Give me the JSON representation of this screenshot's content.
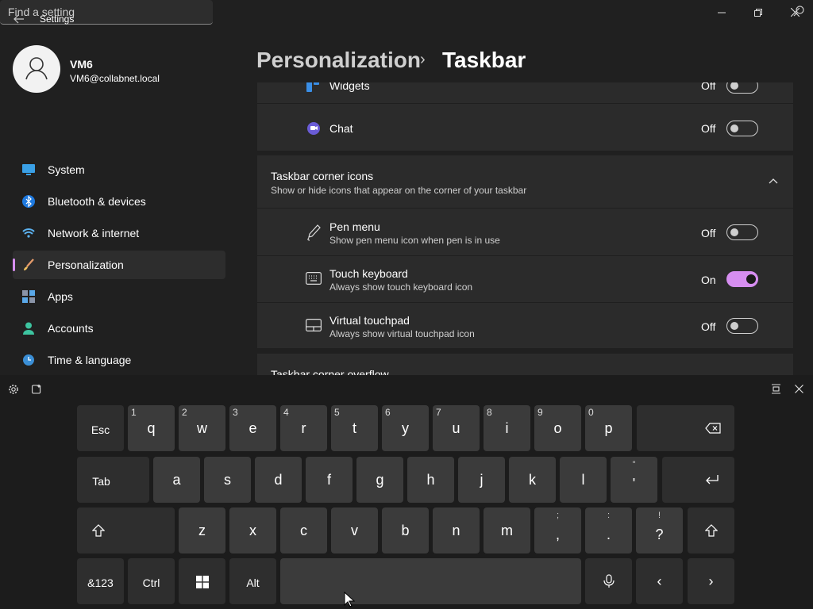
{
  "app": {
    "title": "Settings"
  },
  "window": {
    "minimize": "—",
    "maximize": "❐",
    "close": "✕"
  },
  "profile": {
    "name": "VM6",
    "email": "VM6@collabnet.local"
  },
  "search": {
    "placeholder": "Find a setting"
  },
  "sidebar": {
    "items": [
      {
        "label": "System"
      },
      {
        "label": "Bluetooth & devices"
      },
      {
        "label": "Network & internet"
      },
      {
        "label": "Personalization"
      },
      {
        "label": "Apps"
      },
      {
        "label": "Accounts"
      },
      {
        "label": "Time & language"
      }
    ]
  },
  "breadcrumb": {
    "parent": "Personalization",
    "separator": "›",
    "current": "Taskbar"
  },
  "content": {
    "widgets": {
      "label": "Widgets",
      "state": "Off"
    },
    "chat": {
      "label": "Chat",
      "state": "Off"
    },
    "corner_icons": {
      "title": "Taskbar corner icons",
      "subtitle": "Show or hide icons that appear on the corner of your taskbar",
      "items": [
        {
          "title": "Pen menu",
          "subtitle": "Show pen menu icon when pen is in use",
          "state": "Off"
        },
        {
          "title": "Touch keyboard",
          "subtitle": "Always show touch keyboard icon",
          "state": "On"
        },
        {
          "title": "Virtual touchpad",
          "subtitle": "Always show virtual touchpad icon",
          "state": "Off"
        }
      ]
    },
    "overflow": {
      "title": "Taskbar corner overflow"
    }
  },
  "keyboard": {
    "row1": [
      {
        "main": "Esc"
      },
      {
        "main": "q",
        "alt": "1"
      },
      {
        "main": "w",
        "alt": "2"
      },
      {
        "main": "e",
        "alt": "3"
      },
      {
        "main": "r",
        "alt": "4"
      },
      {
        "main": "t",
        "alt": "5"
      },
      {
        "main": "y",
        "alt": "6"
      },
      {
        "main": "u",
        "alt": "7"
      },
      {
        "main": "i",
        "alt": "8"
      },
      {
        "main": "o",
        "alt": "9"
      },
      {
        "main": "p",
        "alt": "0"
      }
    ],
    "row2": [
      {
        "main": "Tab"
      },
      {
        "main": "a"
      },
      {
        "main": "s"
      },
      {
        "main": "d"
      },
      {
        "main": "f"
      },
      {
        "main": "g"
      },
      {
        "main": "h"
      },
      {
        "main": "j"
      },
      {
        "main": "k"
      },
      {
        "main": "l"
      },
      {
        "up": "\"",
        "low": "'"
      }
    ],
    "row3": [
      {
        "main": "z"
      },
      {
        "main": "x"
      },
      {
        "main": "c"
      },
      {
        "main": "v"
      },
      {
        "main": "b"
      },
      {
        "main": "n"
      },
      {
        "main": "m"
      },
      {
        "up": ";",
        "low": ","
      },
      {
        "up": ":",
        "low": "."
      },
      {
        "up": "!",
        "low": "?"
      }
    ],
    "row4": {
      "symbols": "&123",
      "ctrl": "Ctrl",
      "alt": "Alt",
      "left": "‹",
      "right": "›"
    }
  },
  "colors": {
    "accent": "#d68ef0",
    "background": "#202020",
    "card": "#2b2b2b",
    "key": "#3b3b3b"
  }
}
